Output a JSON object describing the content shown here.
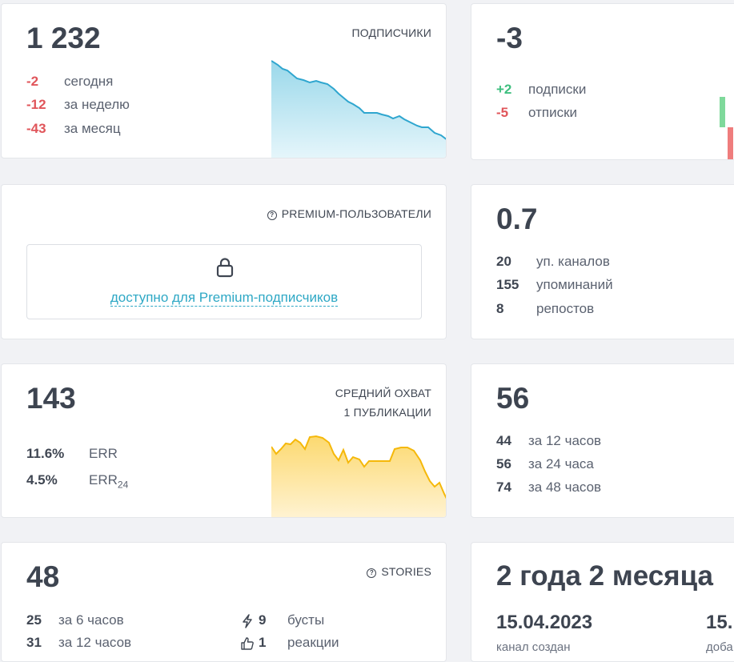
{
  "subscribers": {
    "value": "1 232",
    "label": "ПОДПИСЧИКИ",
    "rows": [
      {
        "value": "-2",
        "text": "сегодня"
      },
      {
        "value": "-12",
        "text": "за неделю"
      },
      {
        "value": "-43",
        "text": "за месяц"
      }
    ],
    "chart_color": "#2fa6cf"
  },
  "daily_change": {
    "value": "-3",
    "rows": [
      {
        "value": "+2",
        "text": "подписки"
      },
      {
        "value": "-5",
        "text": "отписки"
      }
    ]
  },
  "premium": {
    "label": "PREMIUM-ПОЛЬЗОВАТЕЛИ",
    "lock_text": "доступно для Premium-подписчиков",
    "icon": "lock-icon"
  },
  "citation": {
    "value": "0.7",
    "rows": [
      {
        "value": "20",
        "text": "уп. каналов"
      },
      {
        "value": "155",
        "text": "упоминаний"
      },
      {
        "value": "8",
        "text": "репостов"
      }
    ]
  },
  "reach": {
    "value": "143",
    "label_line1": "СРЕДНИЙ ОХВАТ",
    "label_line2": "1 ПУБЛИКАЦИИ",
    "rows": [
      {
        "value": "11.6%",
        "text": "ERR",
        "sub": ""
      },
      {
        "value": "4.5%",
        "text": "ERR",
        "sub": "24"
      }
    ],
    "chart_color": "#f5b80a"
  },
  "views": {
    "value": "56",
    "rows": [
      {
        "value": "44",
        "text": "за 12 часов"
      },
      {
        "value": "56",
        "text": "за 24 часа"
      },
      {
        "value": "74",
        "text": "за 48 часов"
      }
    ]
  },
  "stories": {
    "value": "48",
    "label": "STORIES",
    "rows_left": [
      {
        "value": "25",
        "text": "за 6 часов"
      },
      {
        "value": "31",
        "text": "за 12 часов"
      }
    ],
    "rows_right": [
      {
        "value": "9",
        "text": "бусты",
        "icon": "bolt-icon"
      },
      {
        "value": "1",
        "text": "реакции",
        "icon": "thumbs-up-icon"
      }
    ]
  },
  "age": {
    "value": "2 года 2 месяца",
    "created_date": "15.04.2023",
    "created_label": "канал создан",
    "added_date": "15.",
    "added_label": "доба"
  }
}
